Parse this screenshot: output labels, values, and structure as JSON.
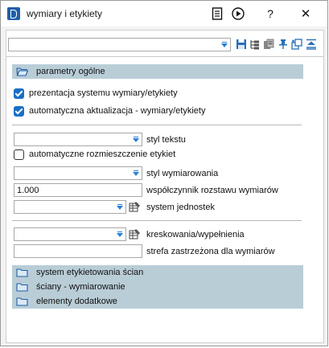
{
  "window": {
    "title": "wymiary i etykiety"
  },
  "titlebar_buttons": {
    "help": "?",
    "close": "✕"
  },
  "toolbar": {
    "preset_value": ""
  },
  "groups": {
    "general": "parametry ogólne",
    "labels_system": "system etykietowania ścian",
    "walls_dimensioning": "ściany - wymiarowanie",
    "extras": "elementy dodatkowe"
  },
  "options": {
    "show_system": {
      "label": "prezentacja systemu wymiary/etykiety",
      "checked": true
    },
    "auto_update": {
      "label": "automatyczna aktualizacja - wymiary/etykiety",
      "checked": true
    },
    "auto_layout": {
      "label": "automatyczne rozmieszczenie etykiet",
      "checked": false
    }
  },
  "fields": {
    "text_style": {
      "label": "styl tekstu",
      "value": ""
    },
    "dim_style": {
      "label": "styl wymiarowania",
      "value": ""
    },
    "spacing_factor": {
      "label": "współczynnik rozstawu wymiarów",
      "value": "1.000"
    },
    "units_system": {
      "label": "system jednostek",
      "value": ""
    },
    "hatching": {
      "label": "kreskowania/wypełnienia",
      "value": ""
    },
    "reserved_zone": {
      "label": "strefa zastrzeżona dla wymiarów",
      "value": ""
    }
  },
  "colors": {
    "accent": "#1a6fc4",
    "group_bg": "#b9cdd7"
  }
}
